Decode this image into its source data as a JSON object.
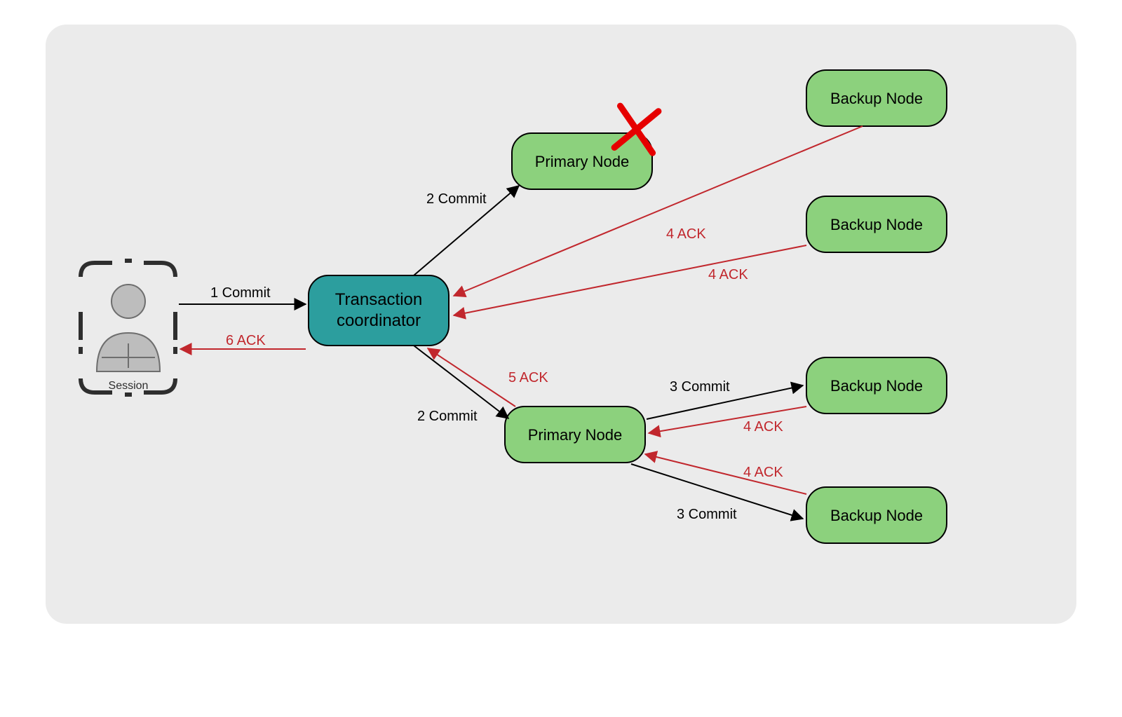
{
  "nodes": {
    "session_label": "Session",
    "coordinator_l1": "Transaction",
    "coordinator_l2": "coordinator",
    "primary1": "Primary Node",
    "primary2": "Primary Node",
    "backup1": "Backup Node",
    "backup2": "Backup Node",
    "backup3": "Backup Node",
    "backup4": "Backup Node"
  },
  "edges": {
    "e1": "1 Commit",
    "e2a": "2 Commit",
    "e2b": "2 Commit",
    "e3a": "3 Commit",
    "e3b": "3 Commit",
    "e4a": "4 ACK",
    "e4b": "4 ACK",
    "e4c": "4 ACK",
    "e4d": "4 ACK",
    "e5": "5 ACK",
    "e6": "6 ACK"
  },
  "colors": {
    "coordinator_fill": "#2c9e9e",
    "node_fill": "#8cd17d",
    "red": "#c1272d",
    "redX": "#e60000"
  }
}
